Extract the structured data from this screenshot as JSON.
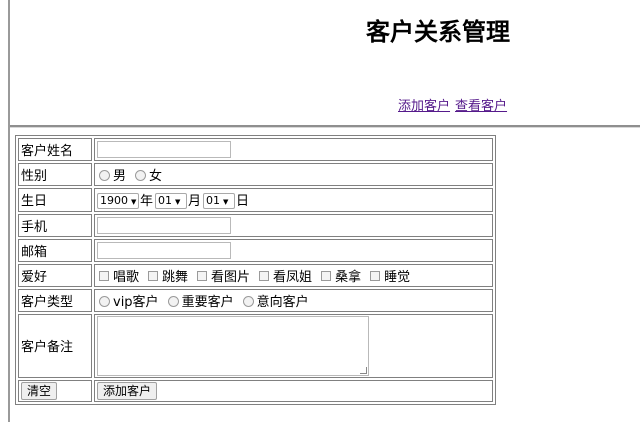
{
  "header": {
    "title": "客户关系管理",
    "nav": {
      "add_label": "添加客户",
      "view_label": "查看客户"
    }
  },
  "form": {
    "name": {
      "label": "客户姓名",
      "value": ""
    },
    "gender": {
      "label": "性别",
      "options": [
        "男",
        "女"
      ]
    },
    "birthday": {
      "label": "生日",
      "year": "1900",
      "year_unit": "年",
      "month": "01",
      "month_unit": "月",
      "day": "01",
      "day_unit": "日"
    },
    "phone": {
      "label": "手机",
      "value": ""
    },
    "email": {
      "label": "邮箱",
      "value": ""
    },
    "hobbies": {
      "label": "爱好",
      "options": [
        "唱歌",
        "跳舞",
        "看图片",
        "看凤姐",
        "桑拿",
        "睡觉"
      ]
    },
    "type": {
      "label": "客户类型",
      "options": [
        "vip客户",
        "重要客户",
        "意向客户"
      ]
    },
    "notes": {
      "label": "客户备注",
      "value": ""
    },
    "buttons": {
      "reset_label": "清空",
      "submit_label": "添加客户"
    }
  }
}
